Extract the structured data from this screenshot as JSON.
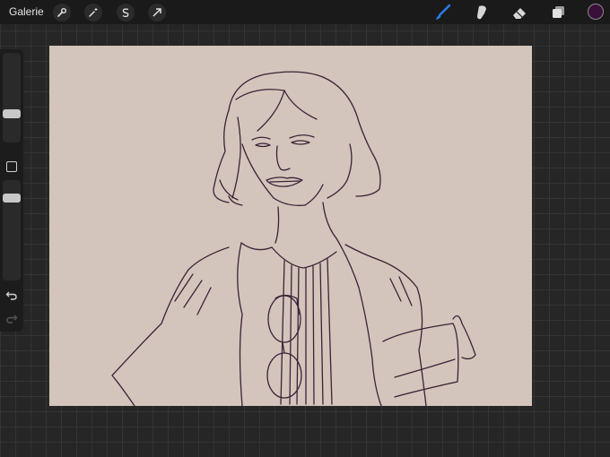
{
  "toolbar": {
    "gallery_label": "Galerie",
    "left_tools": [
      "wrench-icon",
      "magic-wand-icon",
      "selection-s-icon",
      "transform-arrow-icon"
    ],
    "right_tools": [
      "brush-icon",
      "smudge-icon",
      "eraser-icon",
      "layers-icon"
    ],
    "active_tool": "brush-icon",
    "current_color": "#3a0f3a"
  },
  "sidebar": {
    "brush_size_level": 0.3,
    "opacity_level": 0.85,
    "icons": [
      "modify-square-icon",
      "undo-icon",
      "redo-icon"
    ]
  },
  "canvas": {
    "background_color": "#d3c5bb",
    "stroke_color": "#3b2238"
  }
}
